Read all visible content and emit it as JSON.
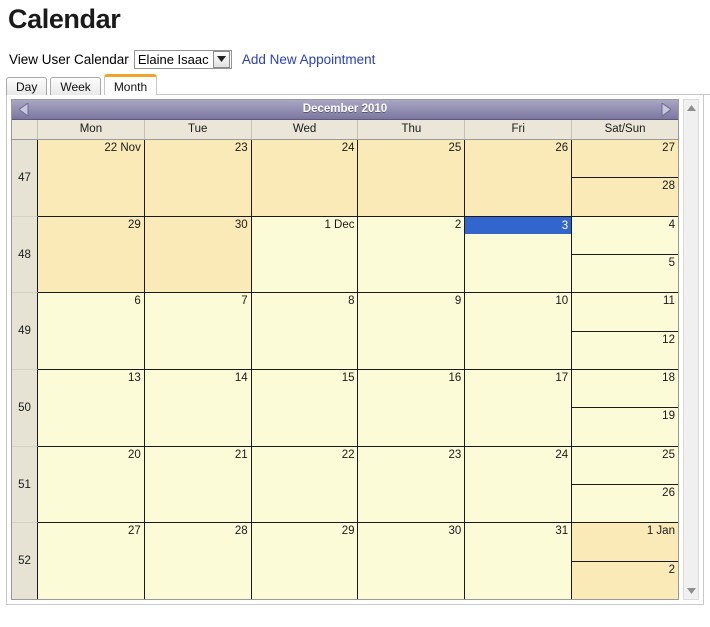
{
  "page": {
    "title": "Calendar"
  },
  "toolbar": {
    "label": "View User Calendar",
    "user_select_value": "Elaine Isaac",
    "add_appointment_label": "Add New Appointment",
    "link_color": "#2b41bf"
  },
  "tabs": [
    {
      "label": "Day",
      "active": false
    },
    {
      "label": "Week",
      "active": false
    },
    {
      "label": "Month",
      "active": true
    }
  ],
  "calendar": {
    "month_title": "December 2010",
    "prev_arrow": "left-triangle",
    "next_arrow": "right-triangle",
    "weekday_headers": [
      "Mon",
      "Tue",
      "Wed",
      "Thu",
      "Fri",
      "Sat/Sun"
    ],
    "colors": {
      "header_gradient_top": "#a9a6c4",
      "header_gradient_bottom": "#7b779f",
      "weekday_header_bg": "#eae7d8",
      "week_number_bg": "#e6e3d4",
      "current_month_cell": "#fcfbd8",
      "other_month_cell": "#faeab8",
      "selected_bg": "#3366cc",
      "selected_text": "#ffffff",
      "grid_line": "#1b1b1b"
    },
    "weeks": [
      {
        "week_number": "47",
        "days": [
          {
            "label": "22 Nov",
            "other_month": true,
            "selected": false
          },
          {
            "label": "23",
            "other_month": true,
            "selected": false
          },
          {
            "label": "24",
            "other_month": true,
            "selected": false
          },
          {
            "label": "25",
            "other_month": true,
            "selected": false
          },
          {
            "label": "26",
            "other_month": true,
            "selected": false
          }
        ],
        "weekend": [
          {
            "label": "27",
            "other_month": true,
            "selected": false
          },
          {
            "label": "28",
            "other_month": true,
            "selected": false
          }
        ]
      },
      {
        "week_number": "48",
        "days": [
          {
            "label": "29",
            "other_month": true,
            "selected": false
          },
          {
            "label": "30",
            "other_month": true,
            "selected": false
          },
          {
            "label": "1 Dec",
            "other_month": false,
            "selected": false
          },
          {
            "label": "2",
            "other_month": false,
            "selected": false
          },
          {
            "label": "3",
            "other_month": false,
            "selected": true
          }
        ],
        "weekend": [
          {
            "label": "4",
            "other_month": false,
            "selected": false
          },
          {
            "label": "5",
            "other_month": false,
            "selected": false
          }
        ]
      },
      {
        "week_number": "49",
        "days": [
          {
            "label": "6",
            "other_month": false,
            "selected": false
          },
          {
            "label": "7",
            "other_month": false,
            "selected": false
          },
          {
            "label": "8",
            "other_month": false,
            "selected": false
          },
          {
            "label": "9",
            "other_month": false,
            "selected": false
          },
          {
            "label": "10",
            "other_month": false,
            "selected": false
          }
        ],
        "weekend": [
          {
            "label": "11",
            "other_month": false,
            "selected": false
          },
          {
            "label": "12",
            "other_month": false,
            "selected": false
          }
        ]
      },
      {
        "week_number": "50",
        "days": [
          {
            "label": "13",
            "other_month": false,
            "selected": false
          },
          {
            "label": "14",
            "other_month": false,
            "selected": false
          },
          {
            "label": "15",
            "other_month": false,
            "selected": false
          },
          {
            "label": "16",
            "other_month": false,
            "selected": false
          },
          {
            "label": "17",
            "other_month": false,
            "selected": false
          }
        ],
        "weekend": [
          {
            "label": "18",
            "other_month": false,
            "selected": false
          },
          {
            "label": "19",
            "other_month": false,
            "selected": false
          }
        ]
      },
      {
        "week_number": "51",
        "days": [
          {
            "label": "20",
            "other_month": false,
            "selected": false
          },
          {
            "label": "21",
            "other_month": false,
            "selected": false
          },
          {
            "label": "22",
            "other_month": false,
            "selected": false
          },
          {
            "label": "23",
            "other_month": false,
            "selected": false
          },
          {
            "label": "24",
            "other_month": false,
            "selected": false
          }
        ],
        "weekend": [
          {
            "label": "25",
            "other_month": false,
            "selected": false
          },
          {
            "label": "26",
            "other_month": false,
            "selected": false
          }
        ]
      },
      {
        "week_number": "52",
        "days": [
          {
            "label": "27",
            "other_month": false,
            "selected": false
          },
          {
            "label": "28",
            "other_month": false,
            "selected": false
          },
          {
            "label": "29",
            "other_month": false,
            "selected": false
          },
          {
            "label": "30",
            "other_month": false,
            "selected": false
          },
          {
            "label": "31",
            "other_month": false,
            "selected": false
          }
        ],
        "weekend": [
          {
            "label": "1 Jan",
            "other_month": true,
            "selected": false
          },
          {
            "label": "2",
            "other_month": true,
            "selected": false
          }
        ]
      }
    ]
  },
  "scrollbar": {
    "up_arrow": "scroll-up",
    "down_arrow": "scroll-down"
  }
}
